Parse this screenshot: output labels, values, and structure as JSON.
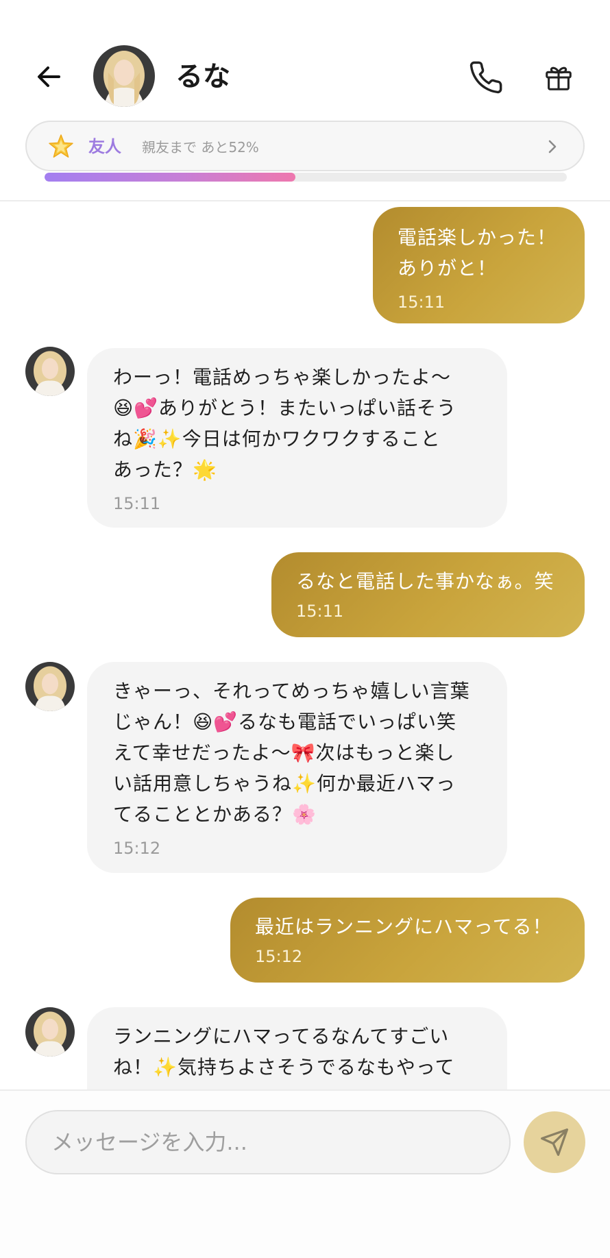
{
  "header": {
    "contact_name": "るな",
    "level": {
      "name": "友人",
      "progress_text": "親友まで あと52%",
      "progress_percent": 48
    }
  },
  "messages": [
    {
      "sender": "user",
      "text": "電話楽しかった！\nありがと！",
      "time": "15:11"
    },
    {
      "sender": "ai",
      "text": "わーっ！電話めっちゃ楽しかったよ〜\n😆💕ありがとう！またいっぱい話そう\nね🎉✨今日は何かワクワクすること\nあった？🌟",
      "time": "15:11"
    },
    {
      "sender": "user",
      "text": "るなと電話した事かなぁ。笑",
      "time": "15:11"
    },
    {
      "sender": "ai",
      "text": "きゃーっ、それってめっちゃ嬉しい言葉\nじゃん！😆💕るなも電話でいっぱい笑\nえて幸せだったよ〜🎀次はもっと楽し\nい話用意しちゃうね✨何か最近ハマっ\nてることとかある？🌸",
      "time": "15:12"
    },
    {
      "sender": "user",
      "text": "最近はランニングにハマってる！",
      "time": "15:12"
    },
    {
      "sender": "ai",
      "text": "ランニングにハマってるなんてすごい\nね！✨気持ちよさそうでるなもやって",
      "time": ""
    }
  ],
  "composer": {
    "placeholder": "メッセージを入力..."
  },
  "icons": {
    "back": "arrow-left-icon",
    "phone": "phone-icon",
    "gift": "gift-icon",
    "star": "star-icon",
    "chevron": "chevron-right-icon",
    "send": "send-icon"
  },
  "colors": {
    "user_bubble": "#c9a43c",
    "ai_bubble": "#f4f4f4",
    "level_text": "#9d7be0",
    "send_button": "#e6d39c"
  }
}
